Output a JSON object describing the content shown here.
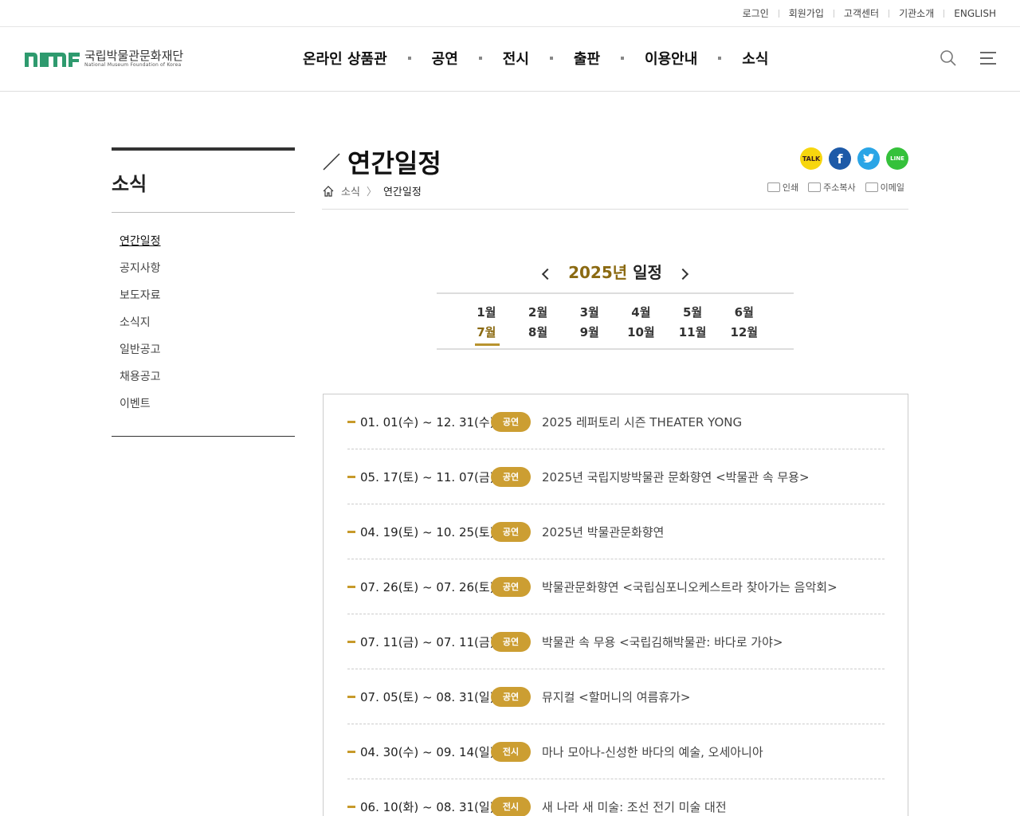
{
  "util_links": [
    "로그인",
    "회원가입",
    "고객센터",
    "기관소개",
    "ENGLISH"
  ],
  "logo": {
    "kr": "국립박물관문화재단",
    "en": "National Museum Foundation of Korea"
  },
  "gnb": [
    "온라인 상품관",
    "공연",
    "전시",
    "출판",
    "이용안내",
    "소식"
  ],
  "lnb": {
    "title": "소식",
    "items": [
      "연간일정",
      "공지사항",
      "보도자료",
      "소식지",
      "일반공고",
      "채용공고",
      "이벤트"
    ]
  },
  "page": {
    "title": "연간일정",
    "breadcrumb": [
      "소식",
      "연간일정"
    ],
    "tools": [
      "인쇄",
      "주소복사",
      "이메일"
    ],
    "sns_icons": [
      "kakaotalk-icon",
      "facebook-icon",
      "twitter-icon",
      "line-icon"
    ]
  },
  "year_nav": {
    "year": "2025년",
    "suffix": " 일정"
  },
  "months_row1": [
    "1월",
    "2월",
    "3월",
    "4월",
    "5월",
    "6월"
  ],
  "months_row2": [
    "7월",
    "8월",
    "9월",
    "10월",
    "11월",
    "12월"
  ],
  "active_month": "7월",
  "schedule": [
    {
      "date": "01. 01(수) ~ 12. 31(수)",
      "type": "공연",
      "title": "2025 레퍼토리 시즌 THEATER YONG"
    },
    {
      "date": "05. 17(토) ~ 11. 07(금)",
      "type": "공연",
      "title": "2025년 국립지방박물관 문화향연 <박물관 속 무용>"
    },
    {
      "date": "04. 19(토) ~ 10. 25(토)",
      "type": "공연",
      "title": "2025년 박물관문화향연"
    },
    {
      "date": "07. 26(토) ~ 07. 26(토)",
      "type": "공연",
      "title": "박물관문화향연 <국립심포니오케스트라 찾아가는 음악회>"
    },
    {
      "date": "07. 11(금) ~ 07. 11(금)",
      "type": "공연",
      "title": "박물관 속 무용 <국립김해박물관: 바다로 가야>"
    },
    {
      "date": "07. 05(토) ~ 08. 31(일)",
      "type": "공연",
      "title": "뮤지컬 <할머니의 여름휴가>"
    },
    {
      "date": "04. 30(수) ~ 09. 14(일)",
      "type": "전시",
      "title": "마나 모아나-신성한 바다의 예술, 오세아니아"
    },
    {
      "date": "06. 10(화) ~ 08. 31(일)",
      "type": "전시",
      "title": "새 나라 새 미술: 조선 전기 미술 대전"
    }
  ],
  "colors": {
    "accent": "#8b6a12",
    "badge": "#cc9e32",
    "logo_green": "#2e9a6e"
  }
}
